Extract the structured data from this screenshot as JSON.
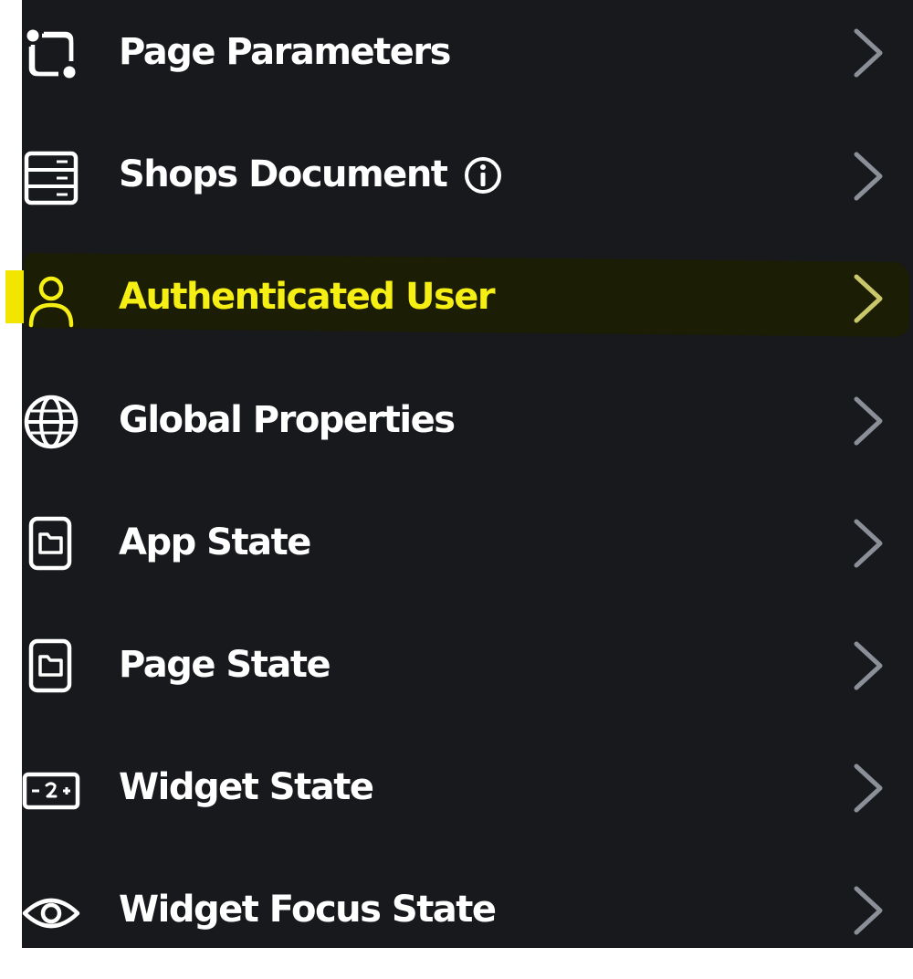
{
  "theme": {
    "panel_bg": "#17191c",
    "text": "#ffffff",
    "highlight_text": "#f5ef14",
    "highlight_marker": "#f2e600",
    "chevron": "#8a8f98"
  },
  "menu": {
    "items": [
      {
        "label": "Page Parameters",
        "icon": "page-parameters-icon",
        "has_info": false,
        "active": false
      },
      {
        "label": "Shops Document",
        "icon": "document-database-icon",
        "has_info": true,
        "active": false
      },
      {
        "label": "Authenticated User",
        "icon": "user-icon",
        "has_info": false,
        "active": true
      },
      {
        "label": "Global Properties",
        "icon": "globe-icon",
        "has_info": false,
        "active": false
      },
      {
        "label": "App State",
        "icon": "app-state-icon",
        "has_info": false,
        "active": false
      },
      {
        "label": "Page State",
        "icon": "page-state-icon",
        "has_info": false,
        "active": false
      },
      {
        "label": "Widget State",
        "icon": "widget-state-icon",
        "has_info": false,
        "active": false
      },
      {
        "label": "Widget Focus State",
        "icon": "eye-icon",
        "has_info": false,
        "active": false
      }
    ]
  }
}
